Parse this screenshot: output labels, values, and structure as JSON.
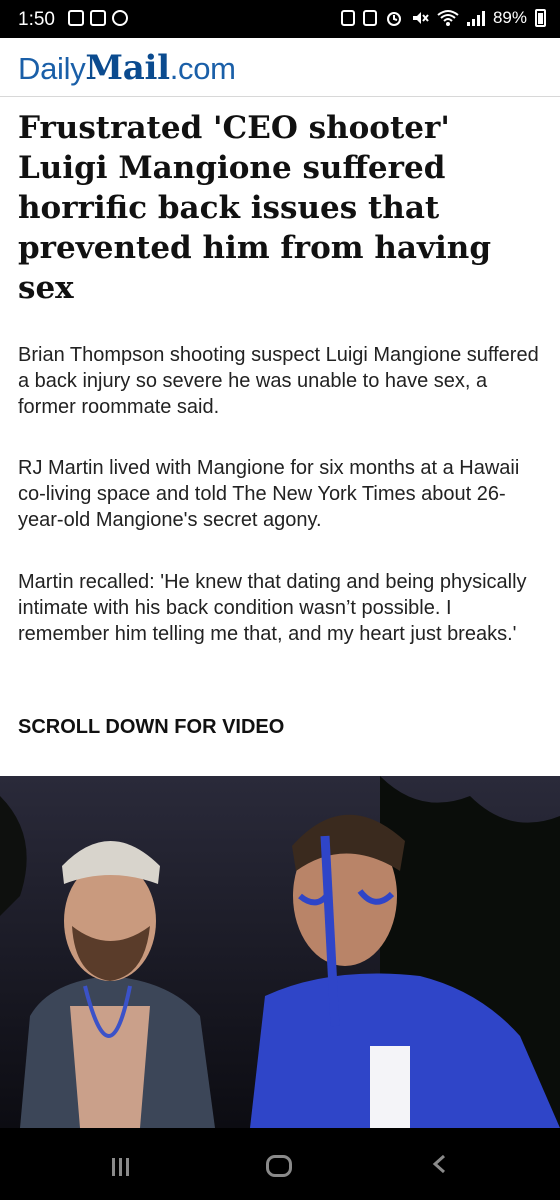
{
  "status_bar": {
    "time": "1:50",
    "battery_percent": "89%",
    "left_icons": [
      "instagram-icon",
      "gallery-icon",
      "threads-icon"
    ],
    "right_icons": [
      "lock-icon",
      "nfc-icon",
      "alarm-icon",
      "mute-icon",
      "wifi-icon",
      "signal-icon",
      "battery-icon"
    ]
  },
  "header": {
    "logo_daily": "Daily",
    "logo_mail": "Mail",
    "logo_com": ".com"
  },
  "article": {
    "headline": "Frustrated 'CEO shooter' Luigi Mangione suffered horrific back issues that prevented him from having sex",
    "paragraphs": [
      "Brian Thompson shooting suspect Luigi Mangione suffered a back injury so severe he was unable to have sex, a former roommate said.",
      "RJ Martin lived with Mangione for six months at a Hawaii co-living space and told The New York Times about 26-year-old Mangione's secret agony.",
      "Martin recalled: 'He knew that dating and being physically intimate with his back condition wasn’t possible. I remember him telling me that, and my heart just breaks.'"
    ],
    "scroll_label": "SCROLL DOWN FOR VIDEO"
  },
  "nav_bar": {
    "icons": [
      "recent-apps-icon",
      "home-icon",
      "back-icon"
    ]
  },
  "colors": {
    "brand_blue": "#1a5fa8",
    "status_bar_bg": "#000000",
    "text": "#222222"
  }
}
